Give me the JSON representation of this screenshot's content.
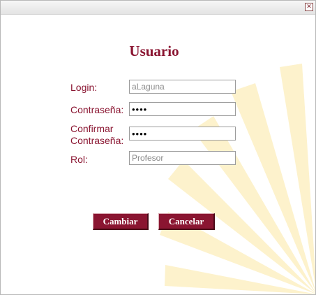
{
  "window": {
    "close_glyph": "✕",
    "close_icon": "close-icon"
  },
  "form": {
    "title": "Usuario",
    "fields": {
      "login": {
        "label": "Login:",
        "value": "aLaguna"
      },
      "password": {
        "label": "Contraseña:",
        "value": "pass"
      },
      "confirm": {
        "label_line1": "Confirmar",
        "label_line2": "Contraseña:",
        "value": "pass"
      },
      "role": {
        "label": "Rol:",
        "value": "Profesor"
      }
    }
  },
  "buttons": {
    "change_label": "Cambiar",
    "cancel_label": "Cancelar"
  },
  "colors": {
    "accent": "#8a1531",
    "background_logo": "#fdf2cc"
  },
  "decor": {
    "background_logo_icon": "sunburst-watermark-icon"
  }
}
